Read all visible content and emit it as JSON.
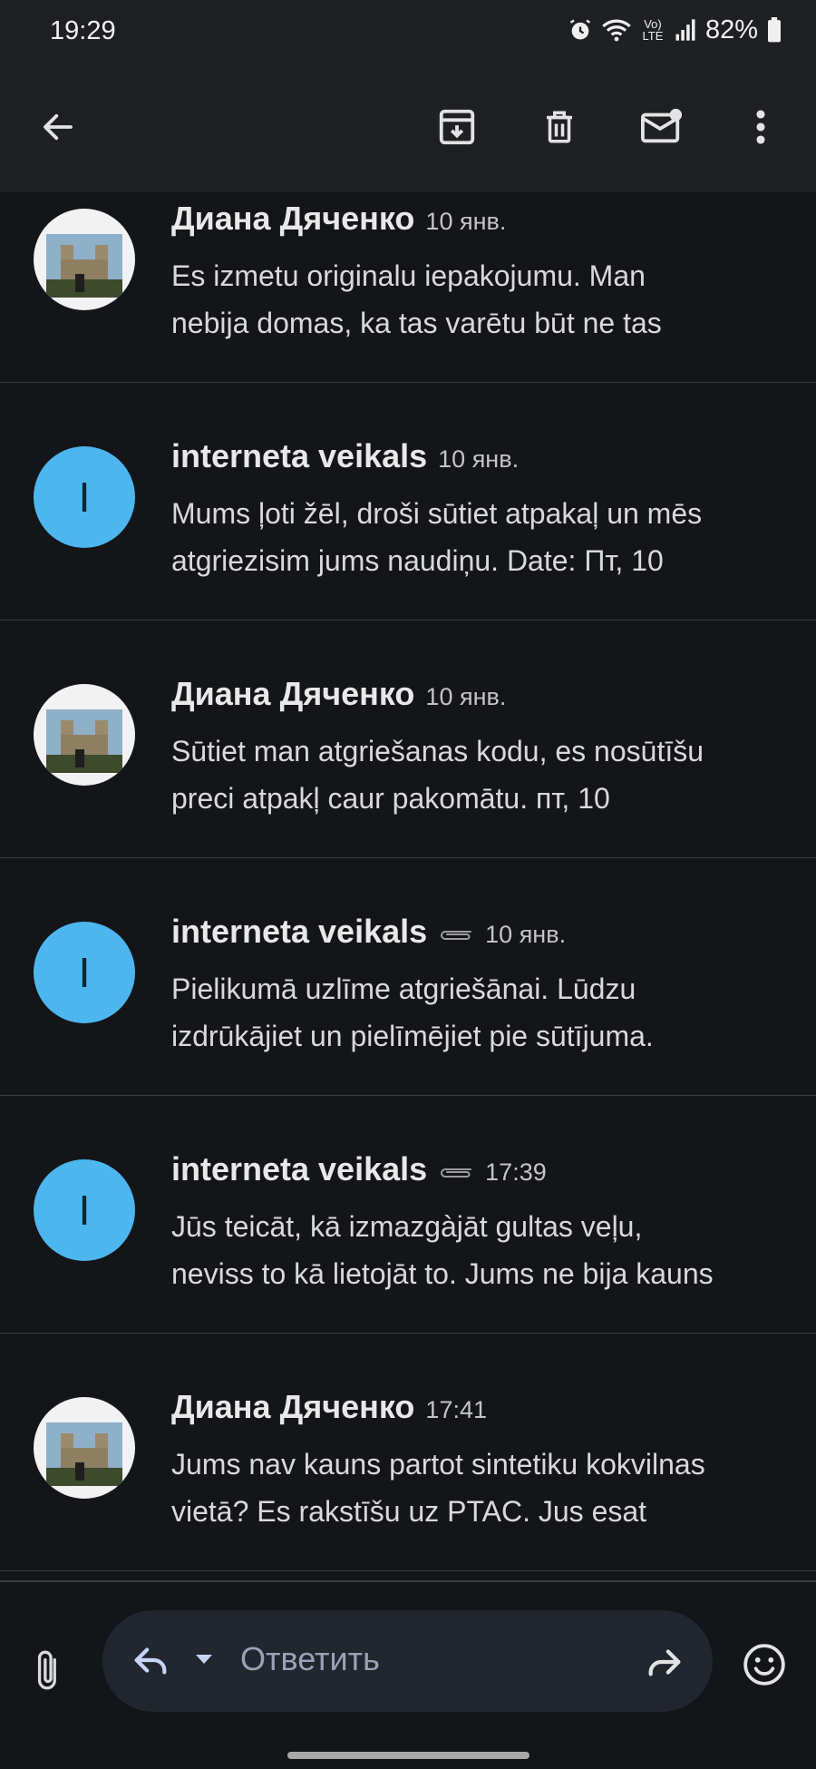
{
  "status_bar": {
    "time": "19:29",
    "network_label": "Vo) LTE",
    "battery": "82%"
  },
  "app_bar": {
    "icons": [
      "back-arrow-icon",
      "archive-icon",
      "delete-icon",
      "mark-unread-icon",
      "more-vert-icon"
    ]
  },
  "messages": [
    {
      "sender": "Диана Дяченко",
      "avatar_type": "photo",
      "has_attachment": false,
      "date": "10 янв.",
      "snippet_lines": [
        "Es izmetu originalu iepakojumu. Man",
        "nebija domas, ka tas varētu būt ne tas"
      ]
    },
    {
      "sender": "interneta veikals",
      "avatar_type": "letter",
      "avatar_letter": "I",
      "has_attachment": false,
      "date": "10 янв.",
      "snippet_lines": [
        "Mums ļoti žēl, droši sūtiet atpakaļ un mēs",
        "atgriezisim jums naudiņu. Date: Пт, 10"
      ]
    },
    {
      "sender": "Диана Дяченко",
      "avatar_type": "photo",
      "has_attachment": false,
      "date": "10 янв.",
      "snippet_lines": [
        "Sūtiet man atgriešanas kodu, es nosūtīšu",
        "preci atpakļ caur pakomātu. пт, 10"
      ]
    },
    {
      "sender": "interneta veikals",
      "avatar_type": "letter",
      "avatar_letter": "I",
      "has_attachment": true,
      "date": "10 янв.",
      "snippet_lines": [
        "Pielikumā uzlīme atgriešānai. Lūdzu",
        "izdrūkājiet un pielīmējiet pie sūtījuma."
      ]
    },
    {
      "sender": "interneta veikals",
      "avatar_type": "letter",
      "avatar_letter": "I",
      "has_attachment": true,
      "date": "17:39",
      "snippet_lines": [
        "Jūs teicāt, kā izmazgàjāt gultas veļu,",
        "neviss to kā lietojāt to. Jums ne bija kauns"
      ]
    },
    {
      "sender": "Диана Дяченко",
      "avatar_type": "photo",
      "has_attachment": false,
      "date": "17:41",
      "snippet_lines": [
        "Jums nav kauns partot sintetiku kokvilnas",
        "vietā? Es rakstīšu uz PTAC. Jus esat"
      ]
    }
  ],
  "compose": {
    "reply_placeholder": "Ответить",
    "icons": [
      "attach-icon",
      "reply-icon",
      "dropdown-icon",
      "forward-icon",
      "emoji-icon"
    ]
  },
  "colors": {
    "background": "#131519",
    "app_bar": "#1e2023",
    "avatar_letter_bg": "#4db6ee",
    "reply_bar": "#22262f",
    "divider": "#3b3d42"
  }
}
